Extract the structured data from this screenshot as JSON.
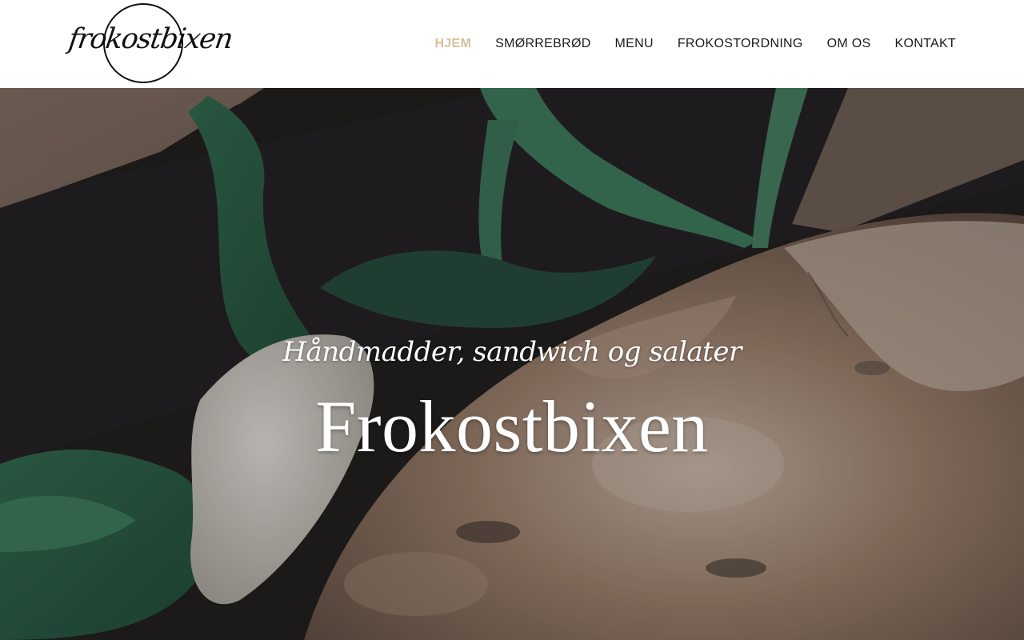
{
  "site": {
    "logo_text": "frokostbixen"
  },
  "nav": {
    "items": [
      {
        "label": "HJEM",
        "active": true
      },
      {
        "label": "SMØRREBRØD",
        "active": false
      },
      {
        "label": "MENU",
        "active": false
      },
      {
        "label": "FROKOSTORDNING",
        "active": false
      },
      {
        "label": "OM OS",
        "active": false
      },
      {
        "label": "KONTAKT",
        "active": false
      }
    ]
  },
  "hero": {
    "tagline": "Håndmadder, sandwich og salater",
    "title": "Frokostbixen"
  },
  "colors": {
    "nav_active": "#d9bf9a",
    "nav_text": "#1a1a1a",
    "hero_text": "#ffffff"
  }
}
